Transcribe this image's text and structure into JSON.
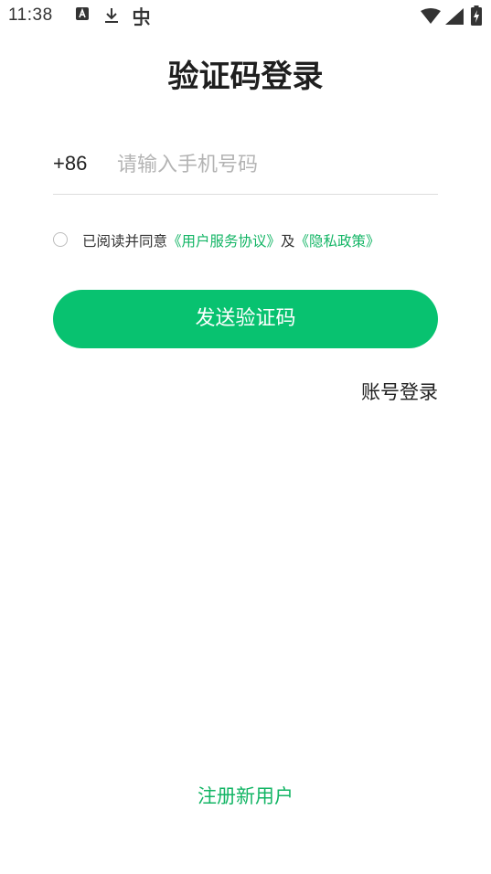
{
  "status_bar": {
    "time": "11:38",
    "left_icons": [
      "a-badge-icon",
      "download-icon",
      "bug-icon"
    ],
    "right_icons": [
      "wifi-icon",
      "signal-icon",
      "battery-charging-icon"
    ]
  },
  "header": {
    "title": "验证码登录"
  },
  "phone_field": {
    "country_code": "+86",
    "value": "",
    "placeholder": "请输入手机号码"
  },
  "agreement": {
    "checked": false,
    "prefix": "已阅读并同意",
    "user_agreement_link": "《用户服务协议》",
    "conjunction": "及",
    "privacy_policy_link": "《隐私政策》"
  },
  "actions": {
    "send_code_label": "发送验证码",
    "account_login_label": "账号登录",
    "register_label": "注册新用户"
  },
  "colors": {
    "primary_green": "#08c270",
    "link_green": "#13b565"
  }
}
